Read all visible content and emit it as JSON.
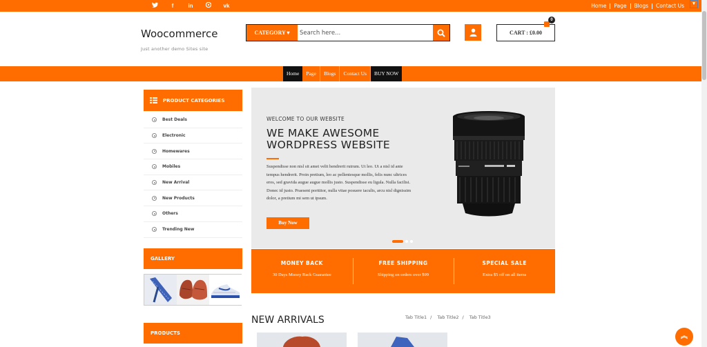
{
  "topbar": {
    "social": [
      "twitter-icon",
      "facebook-icon",
      "linkedin-icon",
      "pinterest-icon",
      "vk-icon"
    ],
    "links": [
      "Home",
      "Page",
      "Blogs",
      "Contact Us"
    ]
  },
  "header": {
    "site_title": "Woocommerce",
    "tagline": "Just another demo Sites site",
    "category_label": "CATEGORY",
    "search_placeholder": "Search here...",
    "cart_label": "CART : £0.00",
    "cart_count": "0"
  },
  "nav": {
    "items": [
      "Home",
      "Page",
      "Blogs",
      "Contact Us",
      "BUY NOW"
    ]
  },
  "sidebar": {
    "categories_title": "PRODUCT CATEGORIES",
    "categories": [
      "Best Deals",
      "Electronic",
      "Homewares",
      "Mobiles",
      "New Arrival",
      "New Products",
      "Others",
      "Trending New"
    ],
    "gallery_title": "GALLERY",
    "products_title": "PRODUCTS"
  },
  "slider": {
    "welcome": "WELCOME TO OUR WEBSITE",
    "headline": "WE MAKE AWESOME WORDPRESS WEBSITE",
    "text": "Suspendisse non nisl sit amet velit hendrerit rutrum. Ut leo. Ut a nisl id ante tempus hendrerit. Proin pretium, leo ac pellentesque mollis, felis nunc ultrices eros, sed gravida augue augue mollis justo. Suspendisse eu ligula. Nulla facilisi. Donec id justo. Praesent porttitor, nulla vitae posuere iaculis, arcu nisl dignissim dolor, a pretium mi sem ut ipsum.",
    "button": "Buy Now"
  },
  "features": [
    {
      "title": "MONEY BACK",
      "subtitle": "30 Days Money Back Guarantee"
    },
    {
      "title": "FREE SHIPPING",
      "subtitle": "Shipping on orders over $99"
    },
    {
      "title": "SPECIAL SALE",
      "subtitle": "Extra $5 off on all items"
    }
  ],
  "arrivals": {
    "title": "NEW ARRIVALS",
    "tabs": [
      "Tab Title1",
      "Tab Title2",
      "Tab Title3"
    ]
  },
  "colors": {
    "accent": "#ff6c00",
    "dark": "#111111"
  }
}
